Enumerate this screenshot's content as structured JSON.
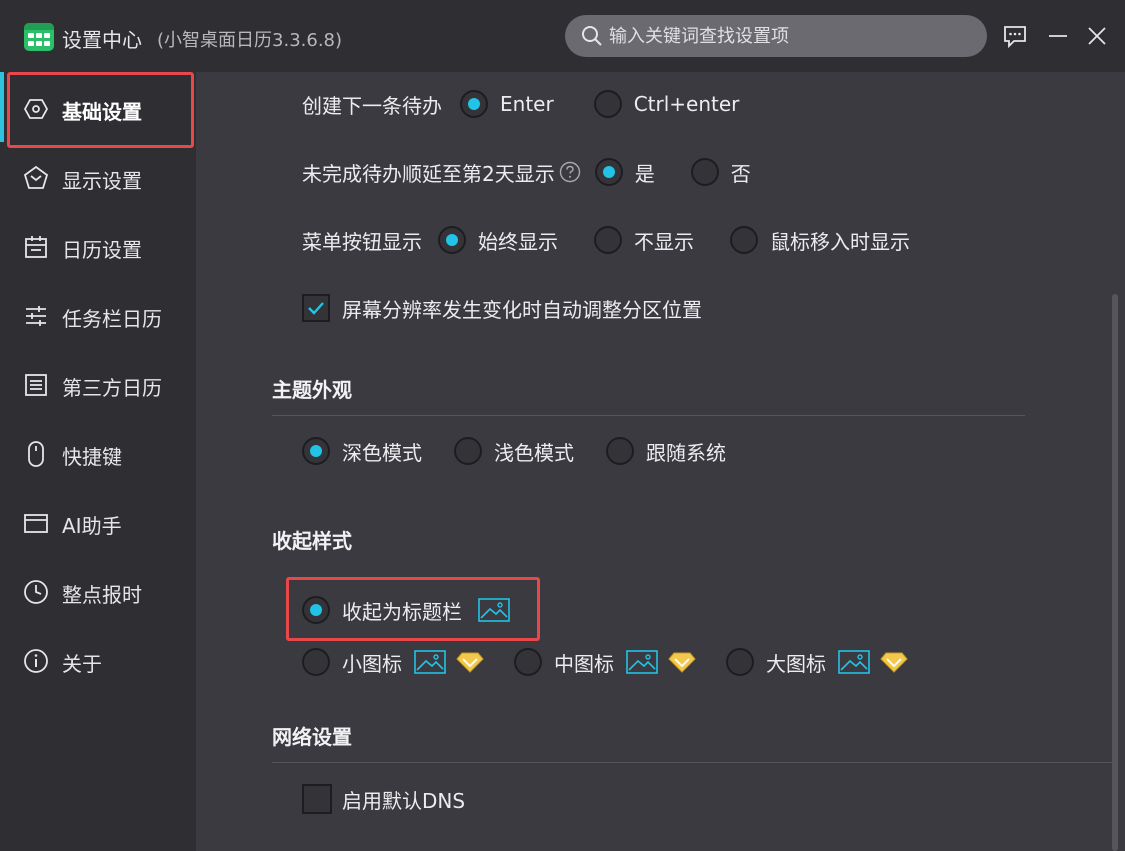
{
  "window": {
    "title": "设置中心",
    "version": "(小智桌面日历3.3.6.8)",
    "search_placeholder": "输入关键词查找设置项"
  },
  "sidebar": {
    "items": [
      {
        "label": "基础设置",
        "icon": "hexagon-icon",
        "active": true
      },
      {
        "label": "显示设置",
        "icon": "pentagon-icon"
      },
      {
        "label": "日历设置",
        "icon": "calendar-icon"
      },
      {
        "label": "任务栏日历",
        "icon": "sliders-icon"
      },
      {
        "label": "第三方日历",
        "icon": "list-box-icon"
      },
      {
        "label": "快捷键",
        "icon": "mouse-icon"
      },
      {
        "label": "AI助手",
        "icon": "window-icon"
      },
      {
        "label": "整点报时",
        "icon": "clock-icon"
      },
      {
        "label": "关于",
        "icon": "info-icon"
      }
    ]
  },
  "settings": {
    "create_next": {
      "label": "创建下一条待办",
      "options": [
        "Enter",
        "Ctrl+enter"
      ],
      "selected": 0
    },
    "postpone": {
      "label": "未完成待办顺延至第2天显示",
      "options": [
        "是",
        "否"
      ],
      "selected": 0
    },
    "menu_button": {
      "label": "菜单按钮显示",
      "options": [
        "始终显示",
        "不显示",
        "鼠标移入时显示"
      ],
      "selected": 0
    },
    "auto_adjust": {
      "label": "屏幕分辨率发生变化时自动调整分区位置",
      "checked": true
    }
  },
  "theme": {
    "title": "主题外观",
    "options": [
      "深色模式",
      "浅色模式",
      "跟随系统"
    ],
    "selected": 0
  },
  "collapse": {
    "title": "收起样式",
    "titlebar_option": "收起为标题栏",
    "options": [
      "小图标",
      "中图标",
      "大图标"
    ],
    "selected": "titlebar"
  },
  "network": {
    "title": "网络设置",
    "dns_label": "启用默认DNS",
    "dns_checked": false
  },
  "colors": {
    "accent": "#21c4e6",
    "highlight": "#e8474b",
    "premium": "#f2c94c"
  }
}
